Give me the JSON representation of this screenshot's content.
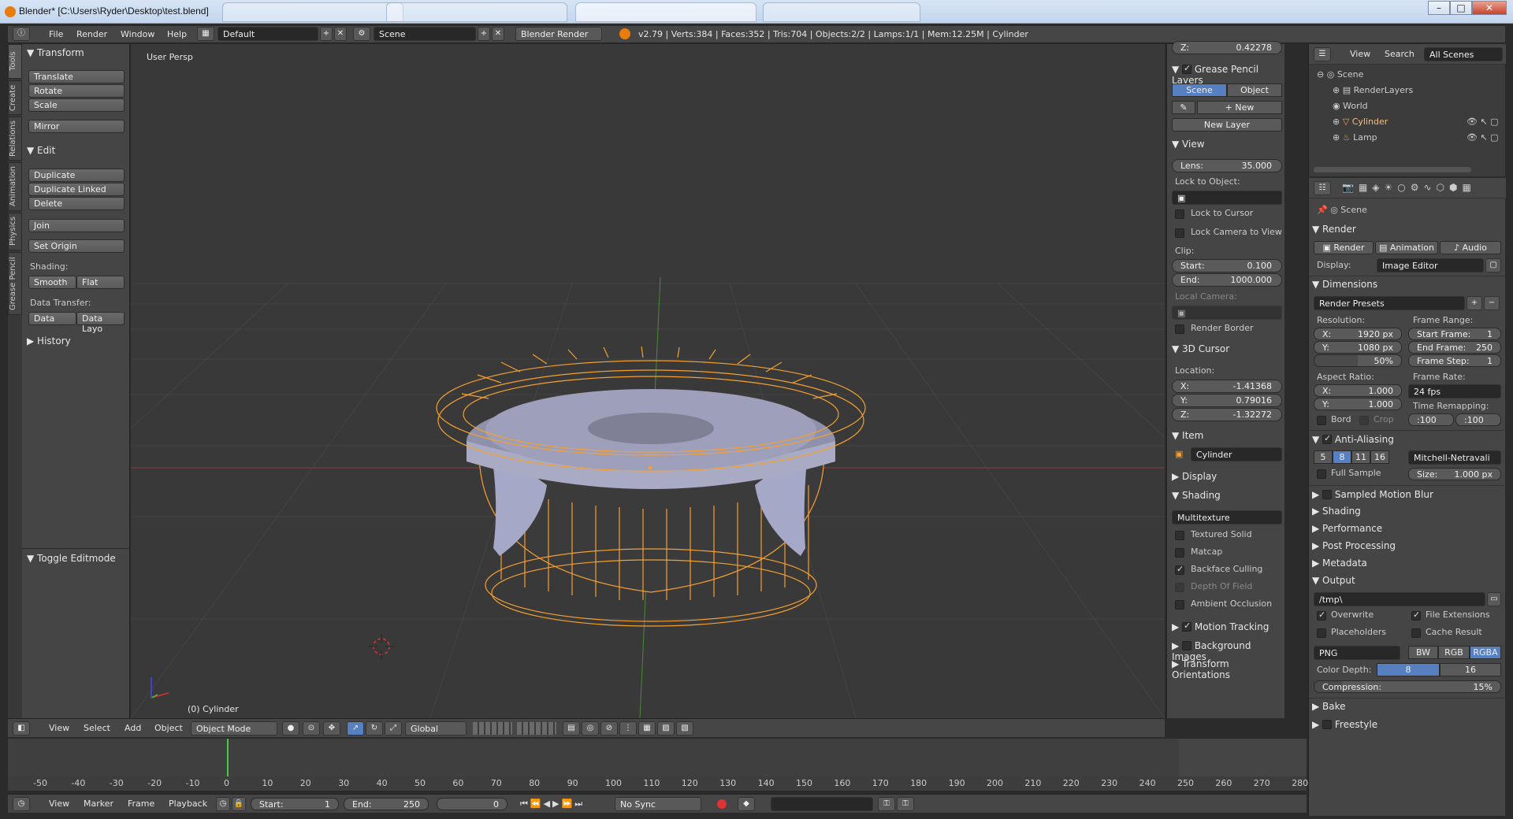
{
  "window": {
    "title": "Blender* [C:\\Users\\Ryder\\Desktop\\test.blend]",
    "controls": [
      "–",
      "□",
      "✕"
    ]
  },
  "topbar": {
    "menus": [
      "File",
      "Render",
      "Window",
      "Help"
    ],
    "layout": "Default",
    "scene": "Scene",
    "engine": "Blender Render",
    "stats": "v2.79 | Verts:384 | Faces:352 | Tris:704 | Objects:2/2 | Lamps:1/1 | Mem:12.25M | Cylinder"
  },
  "lefttabs": [
    "Tools",
    "Create",
    "Relations",
    "Animation",
    "Physics",
    "Grease Pencil"
  ],
  "toolshelf": {
    "transform_title": "Transform",
    "transform_buttons": [
      "Translate",
      "Rotate",
      "Scale"
    ],
    "mirror": "Mirror",
    "edit_title": "Edit",
    "edit_buttons": [
      "Duplicate",
      "Duplicate Linked",
      "Delete"
    ],
    "join": "Join",
    "set_origin": "Set Origin",
    "shading_label": "Shading:",
    "smooth": "Smooth",
    "flat": "Flat",
    "data_transfer_label": "Data Transfer:",
    "data": "Data",
    "data_layo": "Data Layo",
    "history": "History",
    "toggle_editmode": "Toggle Editmode"
  },
  "viewport": {
    "view_name": "User Persp",
    "object_label": "(0) Cylinder"
  },
  "npanel": {
    "z_top": "Z:",
    "z_top_val": "0.42278",
    "grease_title": "Grease Pencil Layers",
    "scene_btn": "Scene",
    "object_btn": "Object",
    "new_btn": "New",
    "new_layer": "New Layer",
    "view_title": "View",
    "lens_label": "Lens:",
    "lens_val": "35.000",
    "lock_to_object": "Lock to Object:",
    "lock_to_cursor": "Lock to Cursor",
    "lock_camera": "Lock Camera to View",
    "clip": "Clip:",
    "start_label": "Start:",
    "start_val": "0.100",
    "end_label": "End:",
    "end_val": "1000.000",
    "local_camera": "Local Camera:",
    "render_border": "Render Border",
    "cursor_title": "3D Cursor",
    "location": "Location:",
    "cx": "X:",
    "cx_val": "-1.41368",
    "cy": "Y:",
    "cy_val": "0.79016",
    "cz": "Z:",
    "cz_val": "-1.32272",
    "item_title": "Item",
    "item_name": "Cylinder",
    "display_title": "Display",
    "shading_title": "Shading",
    "shading_mode": "Multitexture",
    "textured_solid": "Textured Solid",
    "matcap": "Matcap",
    "backface": "Backface Culling",
    "dof": "Depth Of Field",
    "ao": "Ambient Occlusion",
    "motion_tracking": "Motion Tracking",
    "bg_images": "Background Images",
    "transform_orient": "Transform Orientations"
  },
  "outliner": {
    "view": "View",
    "search": "Search",
    "filter": "All Scenes",
    "items": [
      "Scene",
      "RenderLayers",
      "World",
      "Cylinder",
      "Lamp"
    ]
  },
  "props": {
    "scene": "Scene",
    "render_title": "Render",
    "render_btn": "Render",
    "animation_btn": "Animation",
    "audio_btn": "Audio",
    "display_label": "Display:",
    "display_val": "Image Editor",
    "dimensions_title": "Dimensions",
    "render_presets": "Render Presets",
    "resolution": "Resolution:",
    "rx": "X:",
    "rx_val": "1920 px",
    "ry": "Y:",
    "ry_val": "1080 px",
    "pct": "50%",
    "frame_range": "Frame Range:",
    "start_frame": "Start Frame:",
    "start_frame_val": "1",
    "end_frame": "End Frame:",
    "end_frame_val": "250",
    "frame_step": "Frame Step:",
    "frame_step_val": "1",
    "aspect": "Aspect Ratio:",
    "ax": "X:",
    "ax_val": "1.000",
    "ay": "Y:",
    "ay_val": "1.000",
    "frame_rate": "Frame Rate:",
    "fps": "24 fps",
    "time_remap": "Time Remapping:",
    "remap_old": ":100",
    "remap_new": ":100",
    "bord": "Bord",
    "crop": "Crop",
    "aa_title": "Anti-Aliasing",
    "aa_samples": [
      "5",
      "8",
      "11",
      "16"
    ],
    "aa_filter": "Mitchell-Netravali",
    "full_sample": "Full Sample",
    "size_label": "Size:",
    "size_val": "1.000 px",
    "smb": "Sampled Motion Blur",
    "shading": "Shading",
    "performance": "Performance",
    "post": "Post Processing",
    "metadata": "Metadata",
    "output_title": "Output",
    "output_path": "/tmp\\",
    "overwrite": "Overwrite",
    "file_ext": "File Extensions",
    "placeholders": "Placeholders",
    "cache": "Cache Result",
    "format": "PNG",
    "bw": "BW",
    "rgb": "RGB",
    "rgba": "RGBA",
    "color_depth": "Color Depth:",
    "cd8": "8",
    "cd16": "16",
    "compression": "Compression:",
    "compression_val": "15%",
    "bake": "Bake",
    "freestyle": "Freestyle"
  },
  "vpheader": {
    "menus": [
      "View",
      "Select",
      "Add",
      "Object"
    ],
    "mode": "Object Mode",
    "orientation": "Global"
  },
  "timeline": {
    "ticks": [
      "-50",
      "-40",
      "-30",
      "-20",
      "-10",
      "0",
      "10",
      "20",
      "30",
      "40",
      "50",
      "60",
      "70",
      "80",
      "90",
      "100",
      "110",
      "120",
      "130",
      "140",
      "150",
      "160",
      "170",
      "180",
      "190",
      "200",
      "210",
      "220",
      "230",
      "240",
      "250",
      "260",
      "270",
      "280"
    ],
    "menus": [
      "View",
      "Marker",
      "Frame",
      "Playback"
    ],
    "start_label": "Start:",
    "start_val": "1",
    "end_label": "End:",
    "end_val": "250",
    "current": "0",
    "sync": "No Sync"
  }
}
